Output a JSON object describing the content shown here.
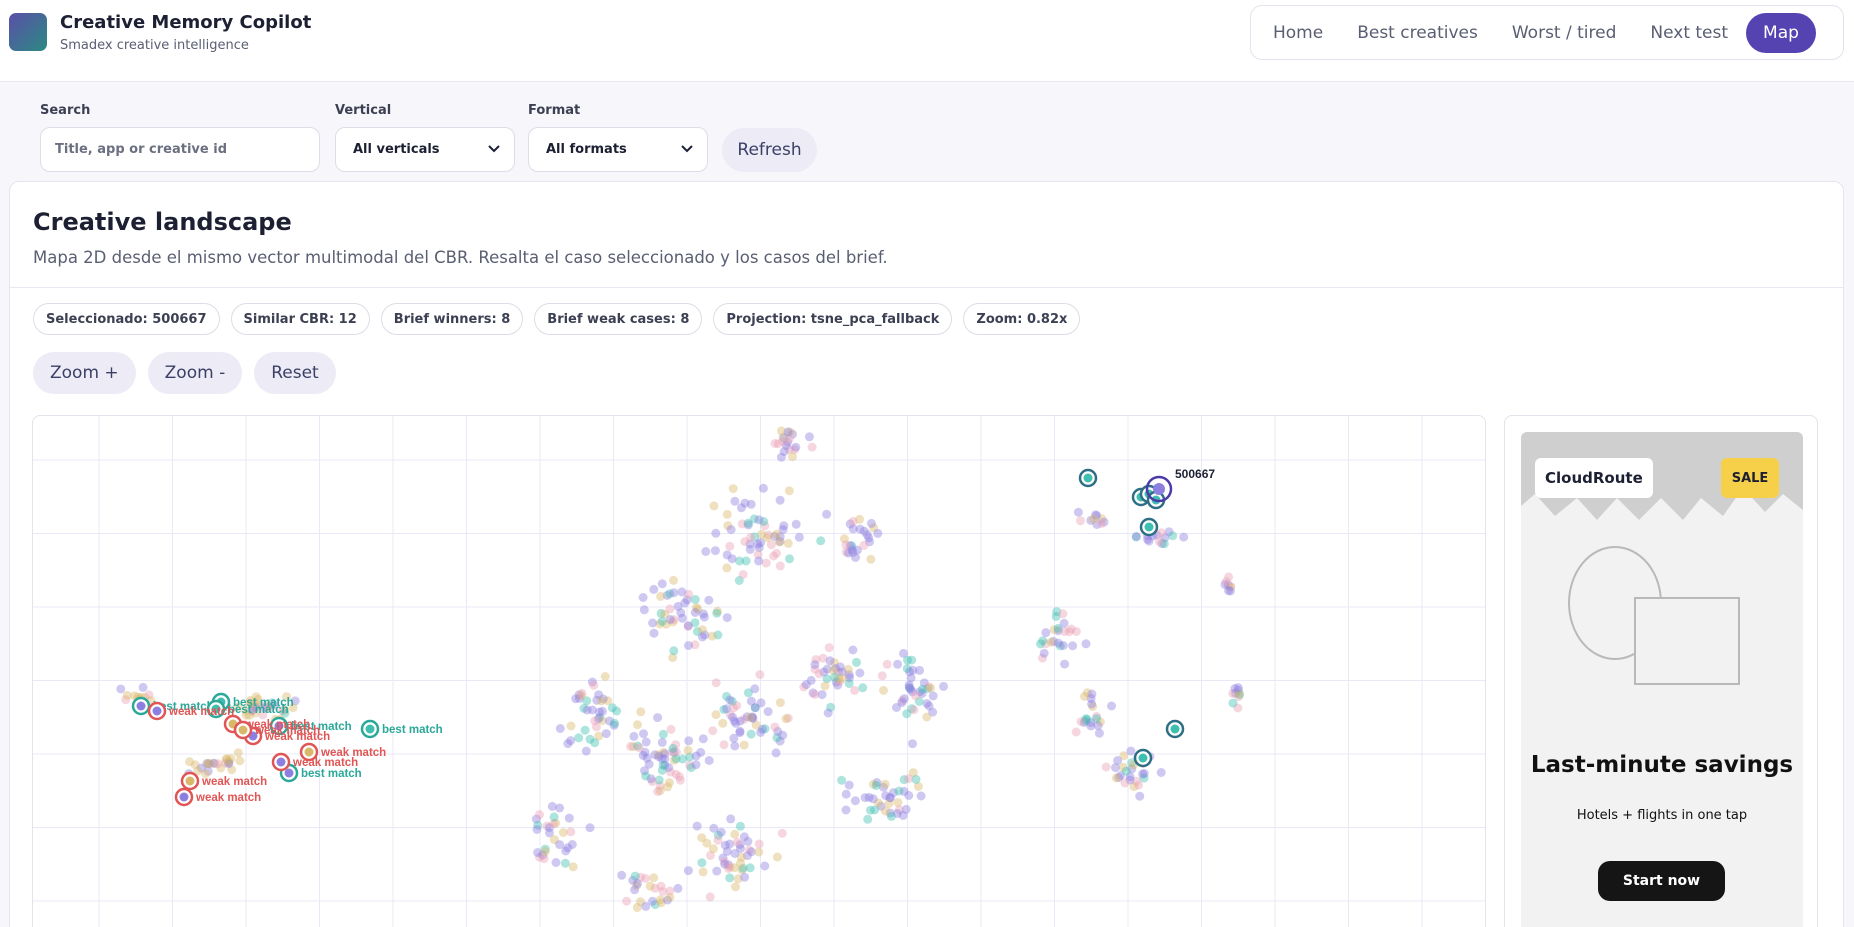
{
  "header": {
    "title": "Creative Memory Copilot",
    "subtitle": "Smadex creative intelligence",
    "nav": [
      {
        "label": "Home"
      },
      {
        "label": "Best creatives"
      },
      {
        "label": "Worst / tired"
      },
      {
        "label": "Next test"
      },
      {
        "label": "Map",
        "active": true
      }
    ]
  },
  "filters": {
    "search_label": "Search",
    "search_placeholder": "Title, app or creative id",
    "search_value": "",
    "vertical_label": "Vertical",
    "vertical_value": "All verticals",
    "format_label": "Format",
    "format_value": "All formats",
    "refresh_label": "Refresh"
  },
  "landscape": {
    "title": "Creative landscape",
    "description": "Mapa 2D desde el mismo vector multimodal del CBR. Resalta el caso seleccionado y los casos del brief.",
    "chips": [
      "Seleccionado: 500667",
      "Similar CBR: 12",
      "Brief winners: 8",
      "Brief weak cases: 8",
      "Projection: tsne_pca_fallback",
      "Zoom: 0.82x"
    ],
    "zoom_in_label": "Zoom +",
    "zoom_out_label": "Zoom -",
    "reset_label": "Reset"
  },
  "map": {
    "selected_label": "500667",
    "best_label": "best match",
    "weak_label": "weak match",
    "colors": {
      "background_point": "#8d7fe0",
      "gold_point": "#d9b86a",
      "teal_point": "#3fbfb0",
      "pink_point": "#e9a0b5",
      "best_ring": "#2ba89a",
      "weak_ring": "#e05555",
      "similar_ring": "#2e6f86",
      "selected_ring": "#4b3aa8"
    }
  },
  "ad_preview": {
    "brand": "CloudRoute",
    "badge": "SALE",
    "headline": "Last-minute savings",
    "subline": "Hotels + flights in one tap",
    "cta": "Start now"
  }
}
